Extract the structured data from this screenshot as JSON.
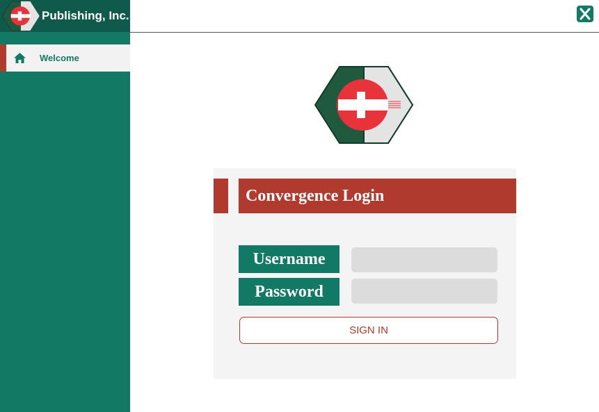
{
  "window": {
    "company_name": "Publishing, Inc.",
    "close_label": "X",
    "close_icon": "close-icon"
  },
  "sidebar": {
    "items": [
      {
        "label": "Welcome",
        "icon": "home-icon",
        "active": true
      }
    ]
  },
  "login": {
    "title": "Convergence Login",
    "username_label": "Username",
    "password_label": "Password",
    "username_value": "",
    "password_value": "",
    "signin_label": "SIGN IN"
  },
  "colors": {
    "brand_green": "#127a64",
    "dark_green": "#0f5a4a",
    "brand_red": "#b03a2e",
    "logo_red": "#e8333b",
    "panel_bg": "#f4f4f4",
    "input_bg": "#dcdcdc"
  }
}
